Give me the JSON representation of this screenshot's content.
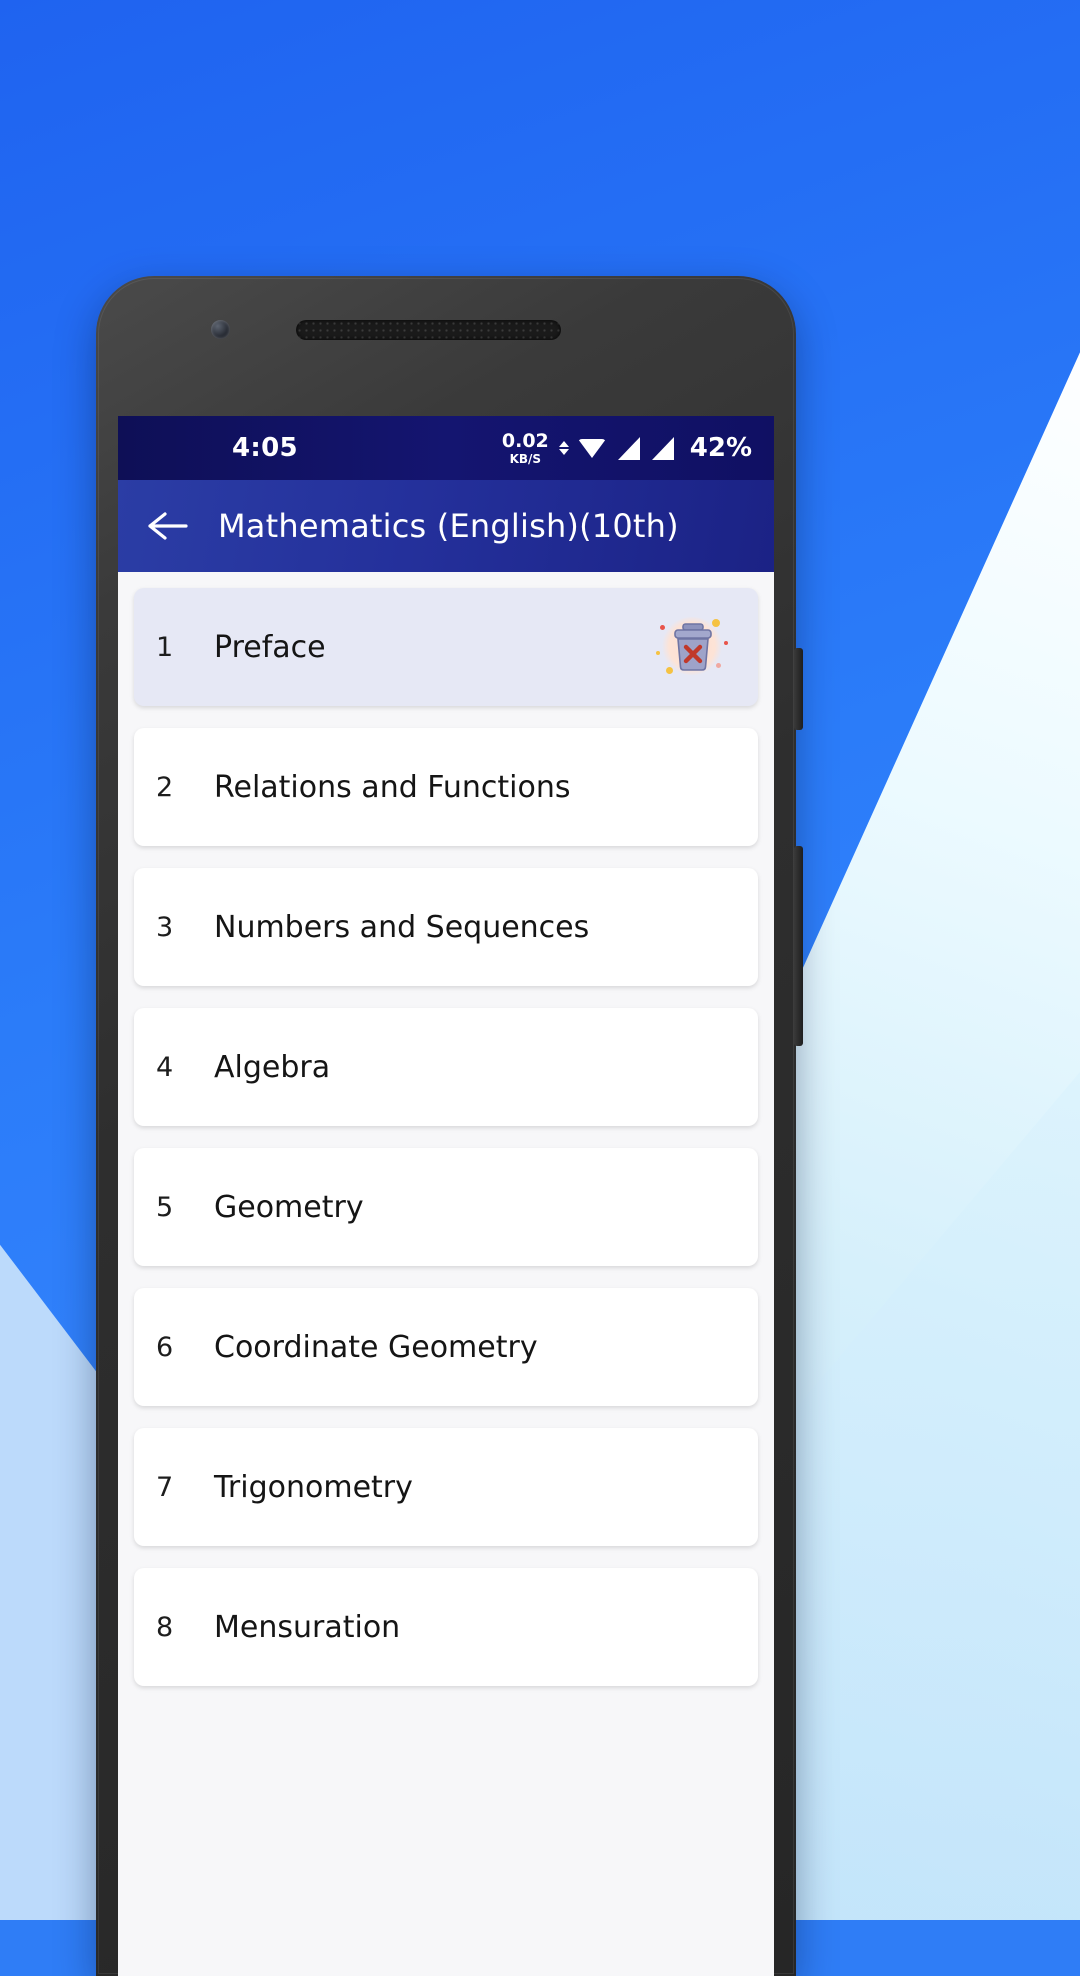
{
  "background": {
    "primary_blue": "#2b7cf9",
    "pale_blue": "#bcdafb",
    "white_wedge": "#ffffff"
  },
  "phone": {
    "camera_icon": "camera-dot",
    "speaker_icon": "earpiece-speaker"
  },
  "statusbar": {
    "time": "4:05",
    "net_speed_value": "0.02",
    "net_speed_unit": "KB/S",
    "wifi_icon": "wifi-icon",
    "signal_icon_1": "signal-bars-icon",
    "signal_icon_2": "signal-bars-icon",
    "battery": "42%",
    "background_color": "#131470"
  },
  "appbar": {
    "back_icon": "back-arrow-icon",
    "title": "Mathematics (English)(10th)",
    "background_color": "#24309b"
  },
  "chapters": [
    {
      "num": "1",
      "title": "Preface",
      "active": true,
      "delete_icon": "delete-trash-icon"
    },
    {
      "num": "2",
      "title": "Relations and Functions",
      "active": false
    },
    {
      "num": "3",
      "title": "Numbers and Sequences",
      "active": false
    },
    {
      "num": "4",
      "title": "Algebra",
      "active": false
    },
    {
      "num": "5",
      "title": "Geometry",
      "active": false
    },
    {
      "num": "6",
      "title": "Coordinate Geometry",
      "active": false
    },
    {
      "num": "7",
      "title": "Trigonometry",
      "active": false
    },
    {
      "num": "8",
      "title": "Mensuration",
      "active": false
    }
  ],
  "colors": {
    "card_bg": "#ffffff",
    "card_active_bg": "#e6e8f5",
    "list_bg": "#f7f7f9",
    "text": "#151515"
  }
}
